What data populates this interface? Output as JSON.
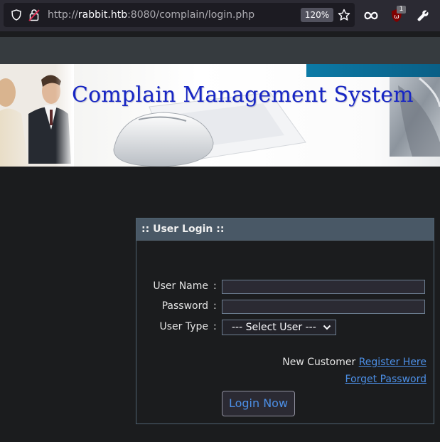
{
  "browser": {
    "url_prefix": "http://",
    "url_host": "rabbit.htb",
    "url_rest": ":8080/complain/login.php",
    "zoom": "120%",
    "extension_badge": "1"
  },
  "banner": {
    "title": "Complain Management System"
  },
  "login": {
    "header": ":: User Login ::",
    "username_label": "User Name",
    "password_label": "Password",
    "usertype_label": "User Type",
    "colon": ":",
    "usertype_selected": "--- Select User ---",
    "new_customer_text": "New Customer",
    "register_link": "Register Here",
    "forget_link": "Forget Password",
    "submit_label": "Login Now"
  },
  "colors": {
    "link": "#4c8fe6",
    "banner_title": "#1726c4",
    "panel_header": "#495866"
  }
}
